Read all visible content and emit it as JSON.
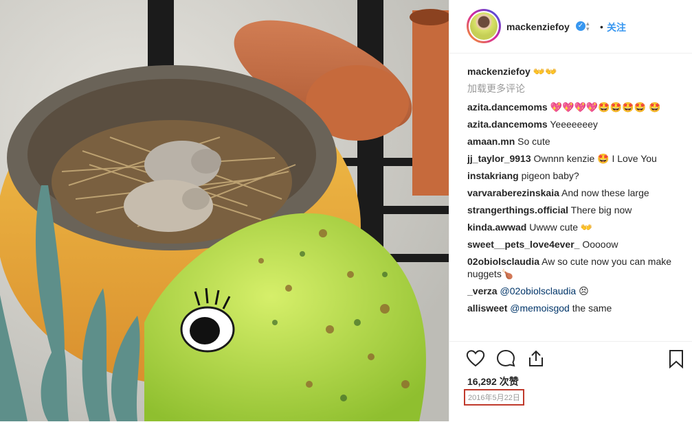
{
  "post": {
    "username": "mackenziefoy",
    "verified_icon": "✓",
    "follow_label": "关注",
    "separator": "•",
    "likes": "16,292 次赞",
    "date": "2016年5月22日"
  },
  "caption": {
    "username": "mackenziefoy",
    "text": "👐👐"
  },
  "load_more": "加载更多评论",
  "comments": [
    {
      "user": "azita.dancemoms",
      "text": "💖💖💖💖🤩🤩🤩🤩 🤩"
    },
    {
      "user": "azita.dancemoms",
      "text": "Yeeeeeeey"
    },
    {
      "user": "amaan.mn",
      "text": "So cute"
    },
    {
      "user": "jj_taylor_9913",
      "text": "Ownnn kenzie 🤩 I Love You"
    },
    {
      "user": "instakriang",
      "text": "pigeon baby?"
    },
    {
      "user": "varvaraberezinskaia",
      "text": "And now these large"
    },
    {
      "user": "strangerthings.official",
      "text": "There big now"
    },
    {
      "user": "kinda.awwad",
      "text": "Uwww cute 👐"
    },
    {
      "user": "sweet__pets_love4ever_",
      "text": "Ooooow"
    },
    {
      "user": "02obiolsclaudia",
      "text": "Aw so cute now you can make nuggets🍗"
    },
    {
      "user": "_verza",
      "mention": "@02obiolsclaudia",
      "text": "😣"
    },
    {
      "user": "allisweet",
      "mention": "@memoisgod",
      "text": "the same"
    }
  ],
  "icons": {
    "like": "heart-icon",
    "comment": "comment-icon",
    "share": "share-icon",
    "save": "bookmark-icon"
  }
}
